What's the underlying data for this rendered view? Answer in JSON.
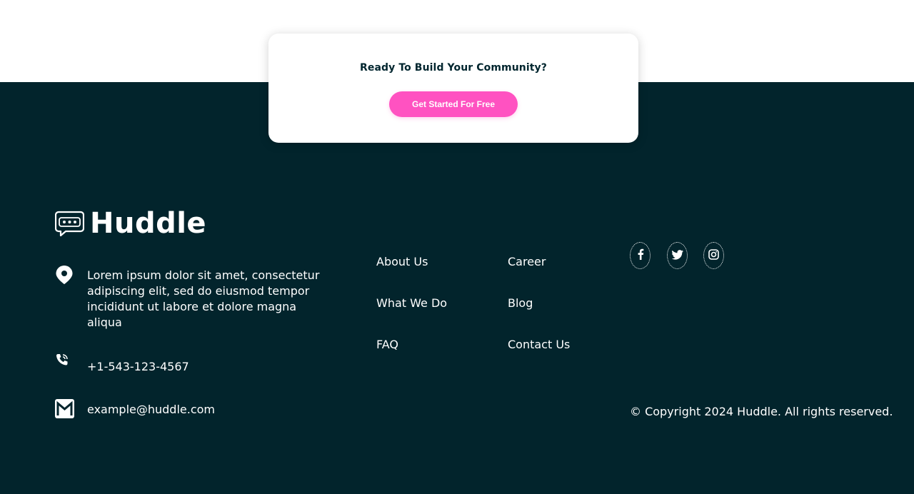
{
  "cta": {
    "heading": "Ready To Build Your Community?",
    "button_label": "Get Started For Free"
  },
  "brand": {
    "name": "Huddle",
    "logo_icon": "chat-bubble-icon"
  },
  "contact": {
    "address": "Lorem ipsum dolor sit amet, consectetur adipiscing elit, sed do eiusmod tempor incididunt ut labore et dolore magna aliqua",
    "phone": "+1-543-123-4567",
    "email": "example@huddle.com"
  },
  "nav": {
    "col1": [
      "About Us",
      "What We Do",
      "FAQ"
    ],
    "col2": [
      "Career",
      "Blog",
      "Contact Us"
    ]
  },
  "social": [
    {
      "name": "facebook",
      "icon": "facebook-icon"
    },
    {
      "name": "twitter",
      "icon": "twitter-icon"
    },
    {
      "name": "instagram",
      "icon": "instagram-icon"
    }
  ],
  "copyright": "© Copyright 2024 Huddle. All rights reserved.",
  "colors": {
    "footer_bg": "#02242c",
    "accent_pink": "#ff52c1",
    "heading_dark": "#00252e",
    "text_white": "#ffffff"
  }
}
